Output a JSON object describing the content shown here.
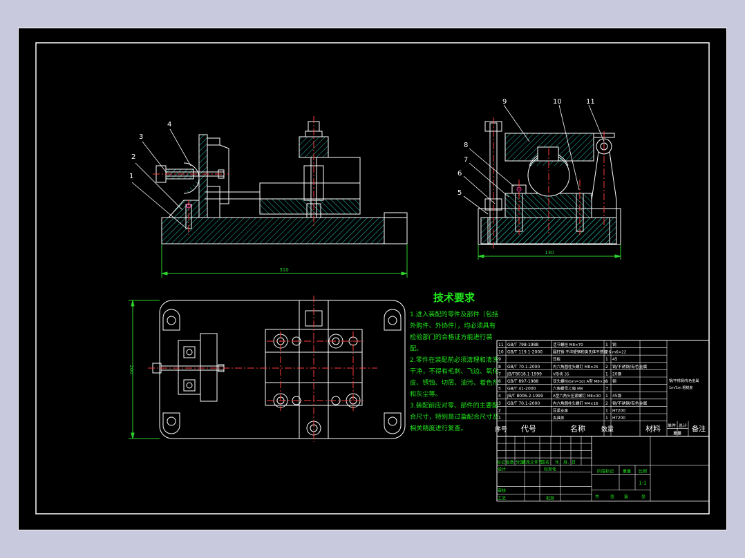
{
  "drawing": {
    "dim_front_width": "310",
    "dim_side_width": "130",
    "dim_top_height": "200",
    "balloons": {
      "front": [
        "1",
        "2",
        "3",
        "4"
      ],
      "side_top": [
        "9",
        "10",
        "11"
      ],
      "side_left": [
        "8",
        "7",
        "6",
        "5"
      ]
    }
  },
  "tech": {
    "title": "技术要求",
    "lines": [
      "1.进入装配的零件及部件（包括",
      "外购件、外协件），均必须具有",
      "检验部门的合格证方能进行装",
      "配。",
      "2.零件在装配前必须清理和清洗",
      "干净，不得有毛刺、飞边、氧化",
      "皮、锈蚀、切屑、油污、着色剂",
      "和灰尘等。",
      "3.装配前应对零、部件的主要配",
      "合尺寸，特别是过盈配合尺寸及",
      "相关精度进行复查。"
    ]
  },
  "bom": {
    "rows": [
      {
        "no": "11",
        "code": "GB/T 798-1988",
        "name": "活节螺栓 M8×70",
        "qty": "1",
        "material": "钢"
      },
      {
        "no": "10",
        "code": "GB/T 119.1-2000",
        "name": "圆柱销 不淬硬钢和奥氏体不锈钢 6 m6×22",
        "qty": "2",
        "material": ""
      },
      {
        "no": "9",
        "code": "",
        "name": "压板",
        "qty": "1",
        "material": "45"
      },
      {
        "no": "8",
        "code": "GB/T 70.1-2000",
        "name": "内六角圆柱头螺钉 M8×25",
        "qty": "2",
        "material": "钢/不锈钢/有色金属"
      },
      {
        "no": "7",
        "code": "JB/T8018.1-1999",
        "name": "V形块 35",
        "qty": "1",
        "material": "20钢"
      },
      {
        "no": "6",
        "code": "GB/T 897-1988",
        "name": "双头螺柱(bm=1d) A型 M8×30",
        "qty": "1",
        "material": "钢"
      },
      {
        "no": "5",
        "code": "GB/T 41-2000",
        "name": "六角螺母-C级 M8",
        "qty": "3",
        "material": ""
      },
      {
        "no": "4",
        "code": "JB/T 8006.2-1999",
        "name": "A型六角头压紧螺钉 M8×30",
        "qty": "1",
        "material": "45钢"
      },
      {
        "no": "3",
        "code": "GB/T 70.1-2000",
        "name": "内六角圆柱头螺钉 M4×16",
        "qty": "2",
        "material": "钢/不锈钢/有色金属"
      },
      {
        "no": "2",
        "code": "",
        "name": "压紧支座",
        "qty": "1",
        "material": "HT200"
      },
      {
        "no": "1",
        "code": "",
        "name": "夹具体",
        "qty": "1",
        "material": "HT200"
      }
    ],
    "side_note": [
      "钢/不锈钢/有色金属",
      "1m/1m 粗糙度"
    ],
    "header": {
      "no": "序号",
      "code": "代号",
      "name": "名称",
      "qty": "数量",
      "material": "材料",
      "unit": "单件",
      "total": "总计",
      "weight": "重量",
      "remark": "备注"
    }
  },
  "titleblock": {
    "row_labels": [
      "标记",
      "处数",
      "分区",
      "更改文件号",
      "签名",
      "年、月、日"
    ],
    "design": "设计",
    "std": "标准化",
    "stage": "阶段标记",
    "weight": "重量",
    "scale": "比例",
    "scale_value": "1:1",
    "audit": "审核",
    "process": "工艺",
    "approve": "批准",
    "sheets": "共",
    "sheet_unit": "张",
    "page": "第",
    "page_unit": "张"
  },
  "colors": {
    "sheet": "#000000",
    "border": "#ffffff",
    "geometry": "#ffffff",
    "hatch": "#21c1b6",
    "centerline": "#ff3a3a",
    "dimension": "#2ed12e",
    "text": "#21e81c",
    "bom_text": "#ffffff",
    "balloon": "#ffffff",
    "hole_accent": "#ff44aa"
  }
}
